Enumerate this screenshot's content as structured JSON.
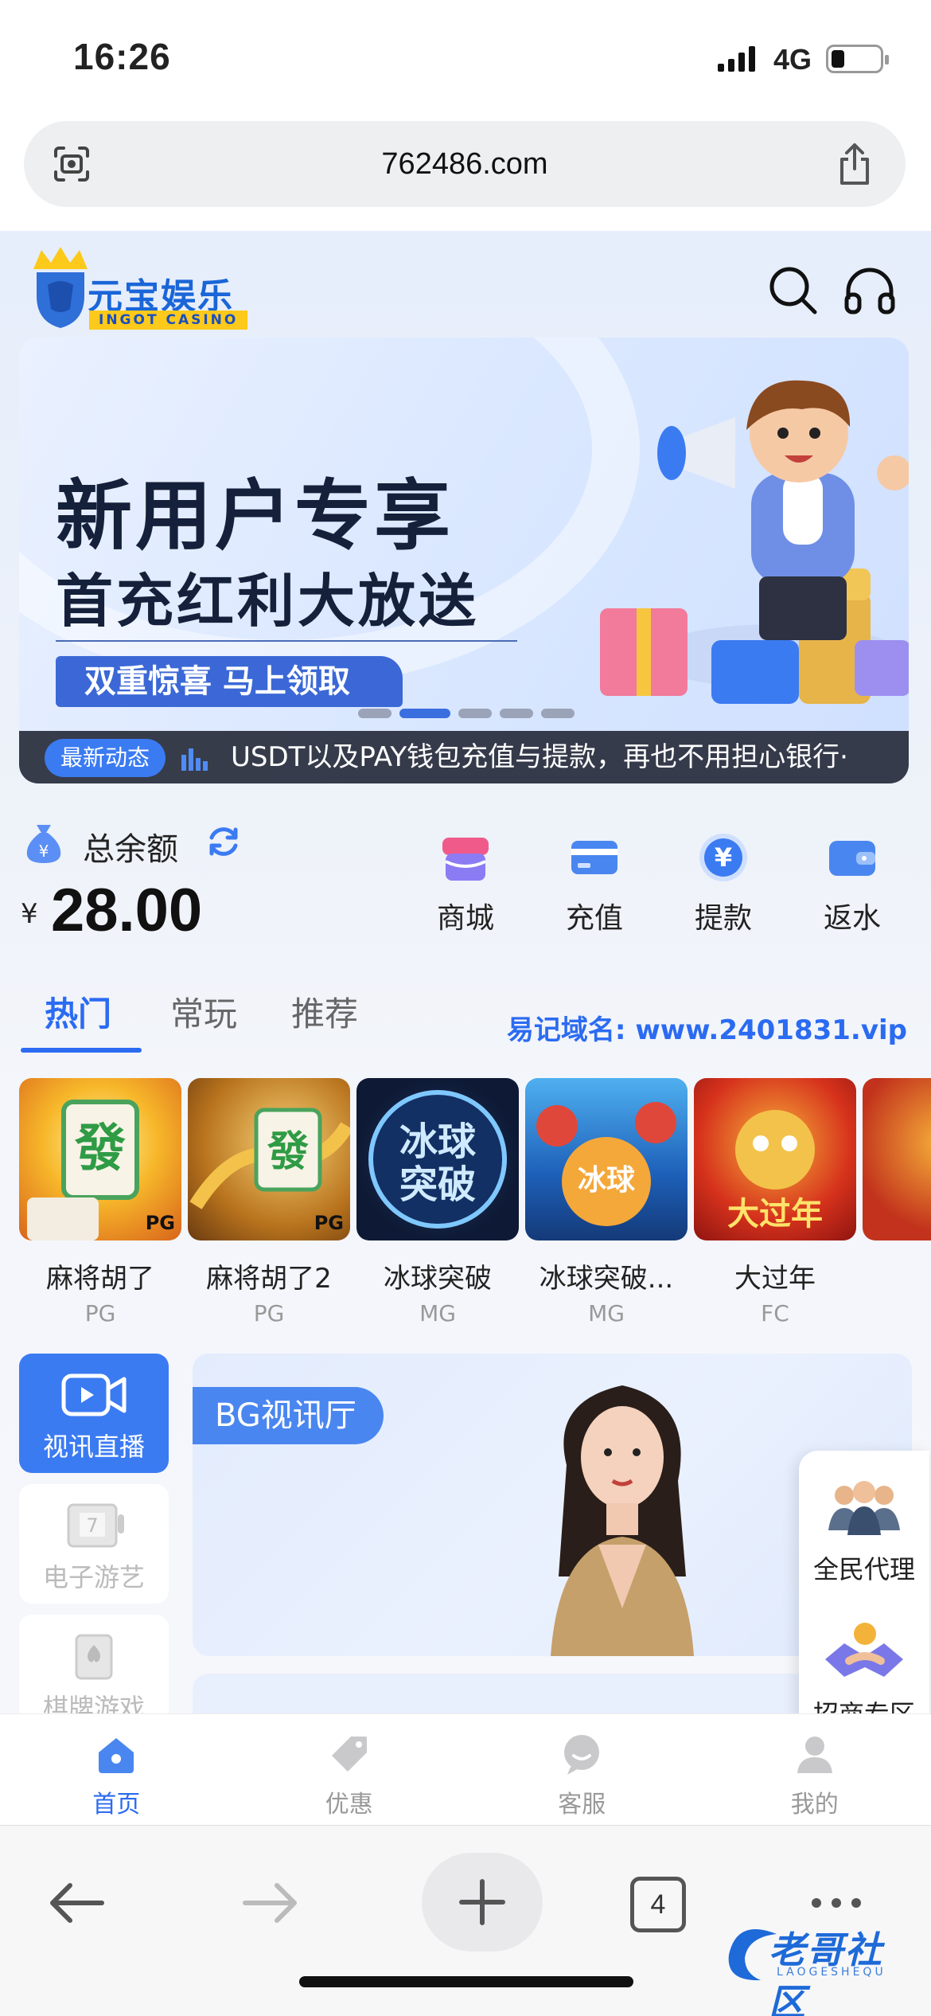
{
  "status": {
    "time": "16:26",
    "network": "4G"
  },
  "browser": {
    "url": "762486.com",
    "tab_count": "4"
  },
  "brand": {
    "name": "元宝娱乐",
    "sub": "INGOT CASINO"
  },
  "banner": {
    "title": "新用户专享",
    "subtitle": "首充红利大放送",
    "pill": "双重惊喜 马上领取",
    "news_tag": "最新动态",
    "news_text": "USDT以及PAY钱包充值与提款，再也不用担心银行·"
  },
  "balance": {
    "label": "总余额",
    "currency": "¥",
    "amount": "28.00"
  },
  "actions": [
    {
      "label": "商城",
      "icon": "shop-icon"
    },
    {
      "label": "充值",
      "icon": "card-icon"
    },
    {
      "label": "提款",
      "icon": "yen-icon"
    },
    {
      "label": "返水",
      "icon": "wallet-icon"
    }
  ],
  "tabs": [
    {
      "label": "热门",
      "active": true
    },
    {
      "label": "常玩",
      "active": false
    },
    {
      "label": "推荐",
      "active": false
    }
  ],
  "domain_hint": "易记域名: www.2401831.vip",
  "games": [
    {
      "name": "麻将胡了",
      "provider": "PG"
    },
    {
      "name": "麻将胡了2",
      "provider": "PG"
    },
    {
      "name": "冰球突破",
      "provider": "MG"
    },
    {
      "name": "冰球突破...",
      "provider": "MG"
    },
    {
      "name": "大过年",
      "provider": "FC"
    },
    {
      "name": "",
      "provider": ""
    }
  ],
  "game_art": {
    "thumb_text_ice": "冰球突破",
    "thumb_text_new_year": "大过年",
    "pg_tag": "PG"
  },
  "categories": [
    {
      "label": "视讯直播",
      "active": true
    },
    {
      "label": "电子游艺",
      "active": false
    },
    {
      "label": "棋牌游戏",
      "active": false
    }
  ],
  "hall": {
    "tag": "BG视讯厅"
  },
  "floating": {
    "agent": "全民代理",
    "merchant": "招商专区"
  },
  "bottom_nav": [
    {
      "label": "首页",
      "active": true
    },
    {
      "label": "优惠",
      "active": false
    },
    {
      "label": "客服",
      "active": false
    },
    {
      "label": "我的",
      "active": false
    }
  ],
  "watermark": {
    "text": "老哥社区",
    "sub": "LAOGESHEQU"
  },
  "colors": {
    "accent": "#2b6bf2",
    "brand_yellow": "#fdc91a",
    "banner_text": "#15203a"
  }
}
